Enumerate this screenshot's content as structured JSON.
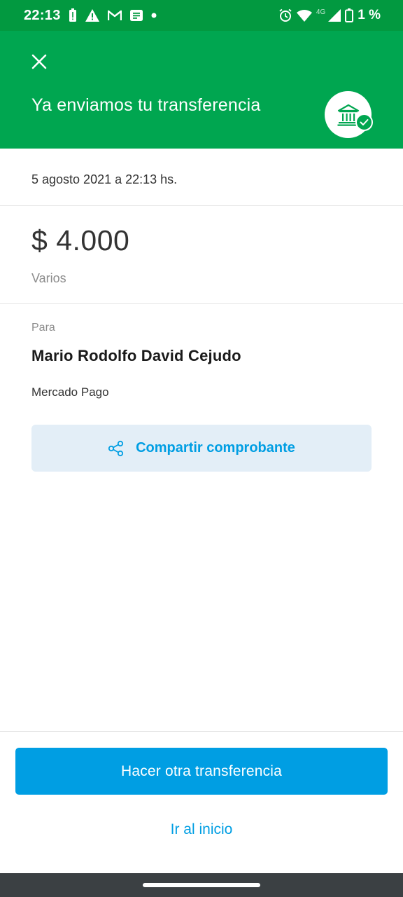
{
  "status_bar": {
    "time": "22:13",
    "network": "4G",
    "battery": "1 %",
    "background": "#029940"
  },
  "header": {
    "title": "Ya enviamos tu transferencia",
    "background": "#00a650"
  },
  "transfer": {
    "date": "5 agosto 2021 a 22:13 hs.",
    "amount": "$ 4.000",
    "concept": "Varios",
    "to_label": "Para",
    "recipient_name": "Mario Rodolfo David Cejudo",
    "recipient_bank": "Mercado Pago"
  },
  "actions": {
    "share_label": "Compartir comprobante",
    "primary_label": "Hacer otra transferencia",
    "secondary_label": "Ir al inicio",
    "accent": "#009ee3"
  },
  "icons": {
    "close": "close-icon",
    "bank": "bank-icon",
    "check": "check-icon",
    "share": "share-icon"
  }
}
